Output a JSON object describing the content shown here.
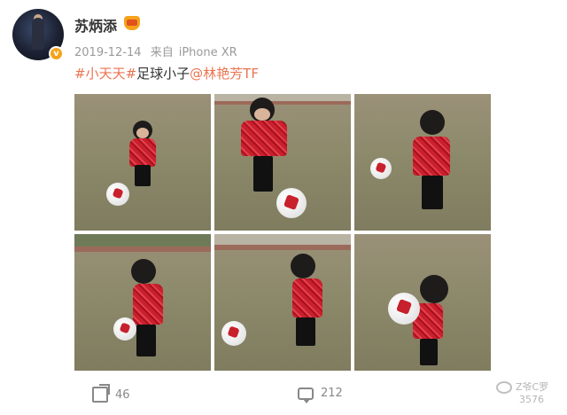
{
  "post": {
    "username": "苏炳添",
    "date": "2019-12-14",
    "source_prefix": "来自",
    "device": "iPhone XR",
    "body": {
      "topic": "#小天天#",
      "text": "足球小子",
      "mention": "@林艳芳TF"
    },
    "photos": [
      {
        "label": "photo-1"
      },
      {
        "label": "photo-2"
      },
      {
        "label": "photo-3"
      },
      {
        "label": "photo-4"
      },
      {
        "label": "photo-5"
      },
      {
        "label": "photo-6"
      }
    ],
    "stats": {
      "shares": "46",
      "comments": "212"
    }
  },
  "icons": {
    "verified": "verified-badge-icon",
    "crown": "vip-crown-icon",
    "share": "share-icon",
    "comment": "comment-icon",
    "watermark": "wechat-icon"
  },
  "watermark": {
    "line1": "Z爷C罗",
    "line2": "3576"
  },
  "colors": {
    "accent": "#eb7350",
    "badge": "#f7a21b",
    "meta": "#9a9a9a"
  }
}
